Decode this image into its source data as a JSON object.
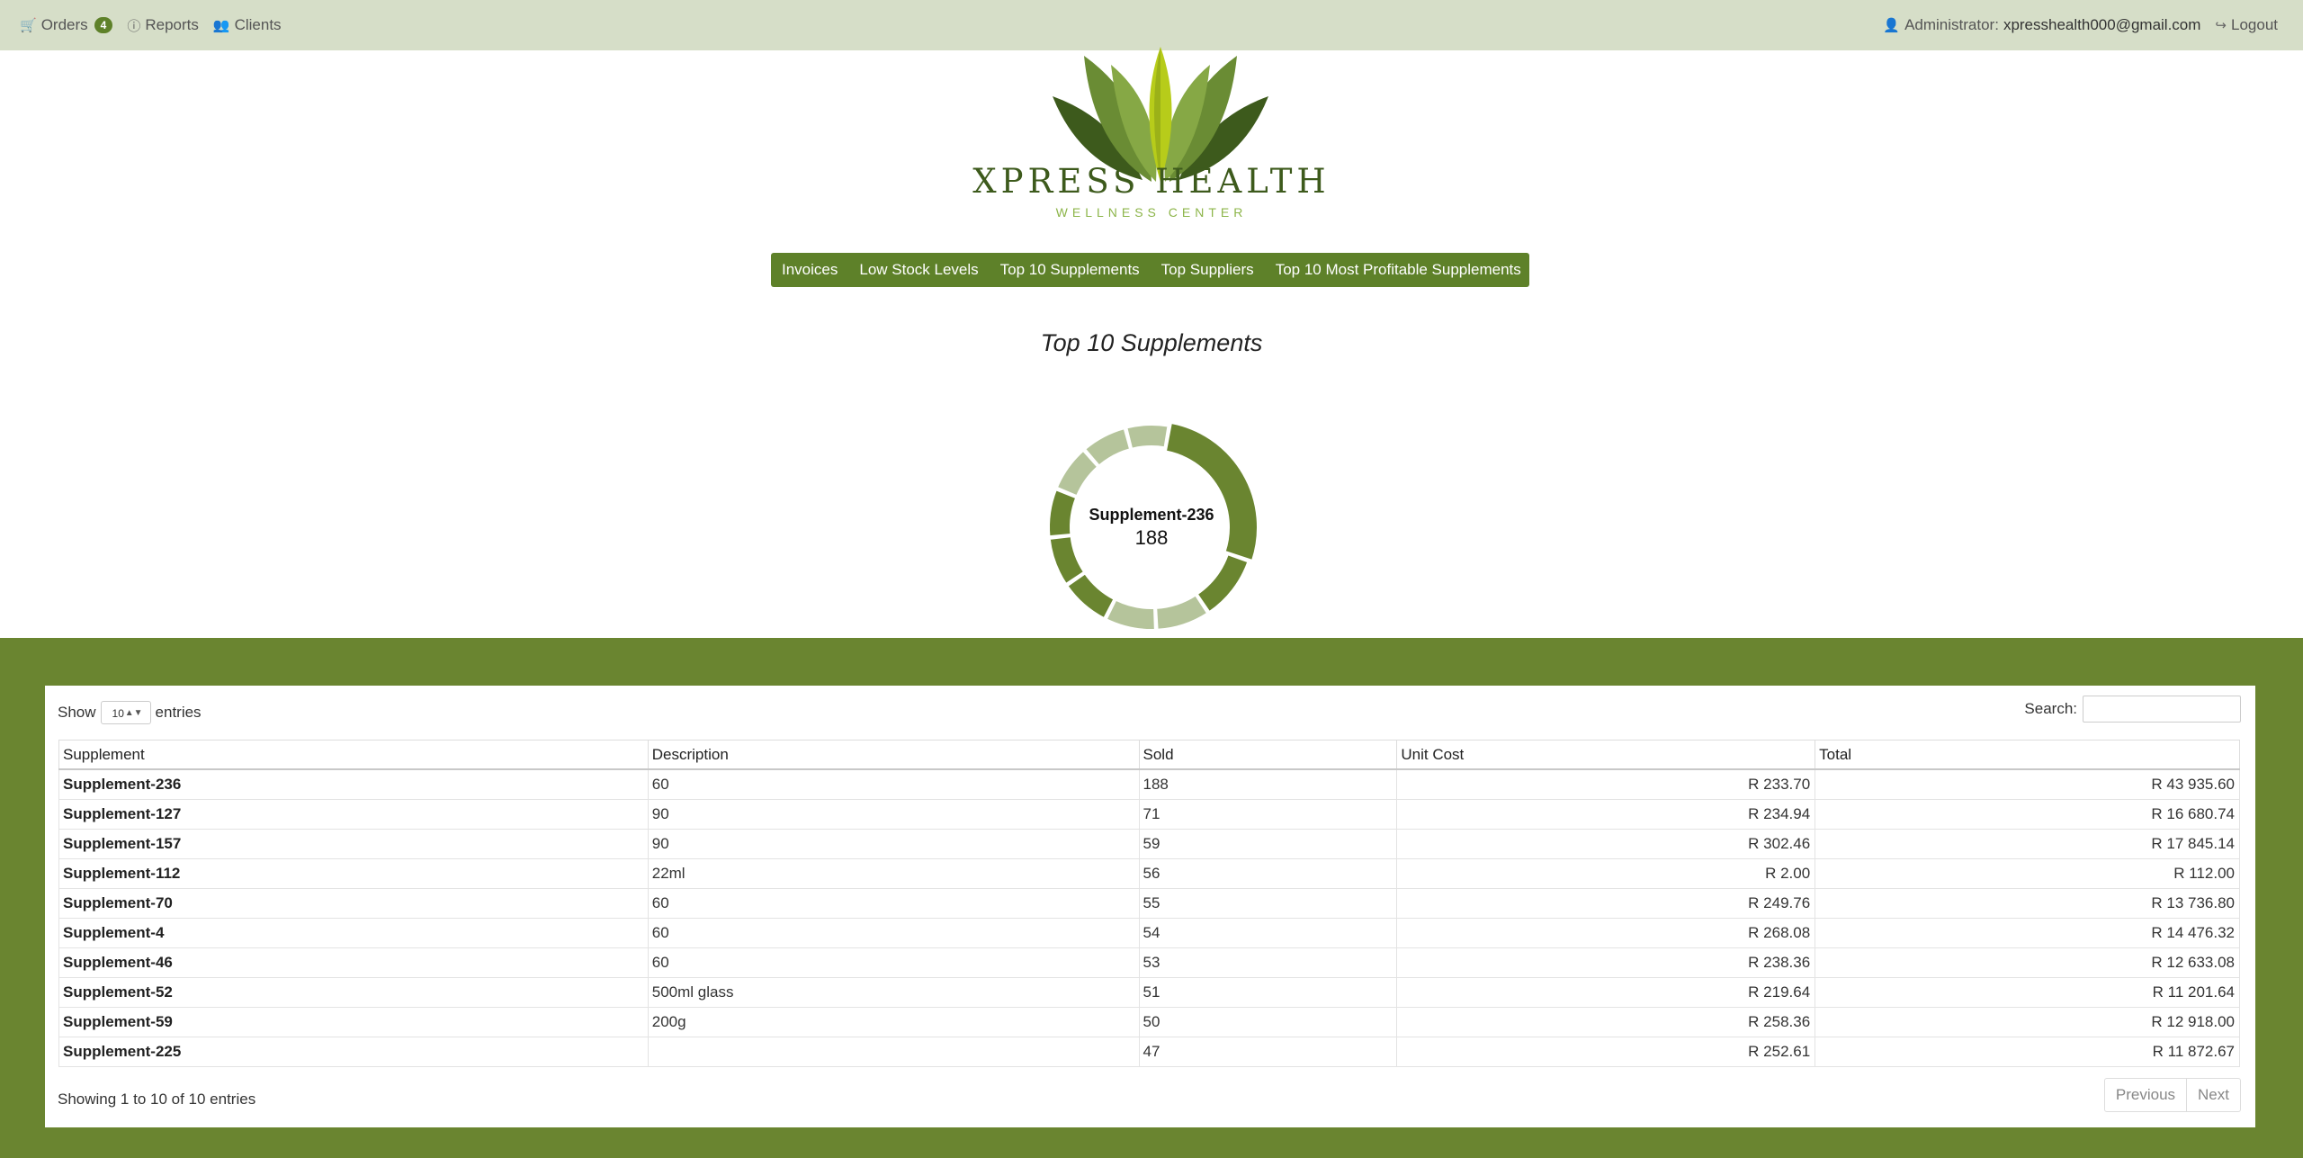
{
  "topbar": {
    "orders_label": "Orders",
    "orders_count": "4",
    "reports_label": "Reports",
    "clients_label": "Clients",
    "admin_label": "Administrator:",
    "admin_email": "xpresshealth000@gmail.com",
    "logout_label": "Logout"
  },
  "brand": {
    "title": "XPRESS HEALTH",
    "subtitle": "WELLNESS CENTER"
  },
  "menu": {
    "items": [
      "Invoices",
      "Low Stock Levels",
      "Top 10 Supplements",
      "Top Suppliers",
      "Top 10 Most Profitable Supplements"
    ]
  },
  "section_title": "Top 10 Supplements",
  "chart_data": {
    "type": "pie",
    "style": "donut",
    "highlighted": {
      "label": "Supplement-236",
      "value": "188"
    },
    "categories": [
      "Supplement-236",
      "Supplement-127",
      "Supplement-157",
      "Supplement-112",
      "Supplement-70",
      "Supplement-4",
      "Supplement-46",
      "Supplement-52",
      "Supplement-59",
      "Supplement-225"
    ],
    "values": [
      188,
      71,
      59,
      56,
      55,
      54,
      53,
      51,
      50,
      47
    ],
    "colors": {
      "dark": "#6a8530",
      "light": "#b5c49b"
    }
  },
  "table": {
    "show_label": "Show",
    "page_size": "10",
    "entries_label": "entries",
    "search_label": "Search:",
    "columns": [
      "Supplement",
      "Description",
      "Sold",
      "Unit Cost",
      "Total"
    ],
    "rows": [
      [
        "Supplement-236",
        "60",
        "188",
        "R 233.70",
        "R 43 935.60"
      ],
      [
        "Supplement-127",
        "90",
        "71",
        "R 234.94",
        "R 16 680.74"
      ],
      [
        "Supplement-157",
        "90",
        "59",
        "R 302.46",
        "R 17 845.14"
      ],
      [
        "Supplement-112",
        "22ml",
        "56",
        "R 2.00",
        "R 112.00"
      ],
      [
        "Supplement-70",
        "60",
        "55",
        "R 249.76",
        "R 13 736.80"
      ],
      [
        "Supplement-4",
        "60",
        "54",
        "R 268.08",
        "R 14 476.32"
      ],
      [
        "Supplement-46",
        "60",
        "53",
        "R 238.36",
        "R 12 633.08"
      ],
      [
        "Supplement-52",
        "500ml glass",
        "51",
        "R 219.64",
        "R 11 201.64"
      ],
      [
        "Supplement-59",
        "200g",
        "50",
        "R 258.36",
        "R 12 918.00"
      ],
      [
        "Supplement-225",
        "",
        "47",
        "R 252.61",
        "R 11 872.67"
      ]
    ],
    "info": "Showing 1 to 10 of 10 entries",
    "prev_label": "Previous",
    "next_label": "Next"
  }
}
